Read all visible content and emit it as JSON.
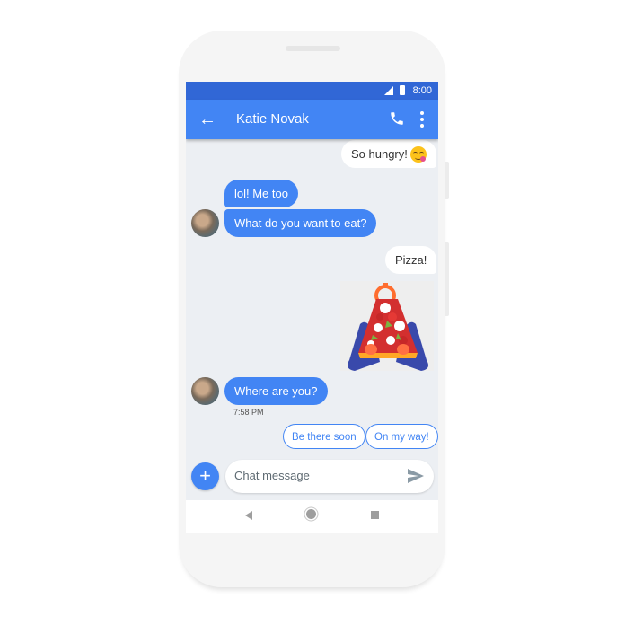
{
  "status_bar": {
    "time": "8:00",
    "icons": [
      "signal-icon",
      "battery-icon"
    ]
  },
  "app_bar": {
    "title": "Katie Novak",
    "back_icon": "arrow-left-icon",
    "actions": [
      "phone-icon",
      "more-vert-icon"
    ]
  },
  "messages": [
    {
      "direction": "outgoing",
      "text": "So hungry!",
      "emoji": "face-savoring-food"
    },
    {
      "direction": "incoming",
      "text": "lol! Me too"
    },
    {
      "direction": "incoming",
      "text": "What do you want to eat?"
    },
    {
      "direction": "outgoing",
      "text": "Pizza!"
    },
    {
      "direction": "outgoing",
      "type": "sticker",
      "sticker": "pizza-slice-sticker"
    },
    {
      "direction": "incoming",
      "text": "Where are you?",
      "timestamp": "7:58 PM"
    }
  ],
  "smart_replies": [
    "Be there soon",
    "On my way!"
  ],
  "composer": {
    "placeholder": "Chat message",
    "add_icon": "plus-icon",
    "send_icon": "send-icon"
  },
  "nav_bar": [
    "back-icon",
    "home-icon",
    "recents-icon"
  ],
  "colors": {
    "primary": "#4285f4",
    "status_bar": "#3167d6",
    "background": "#eceff3"
  }
}
